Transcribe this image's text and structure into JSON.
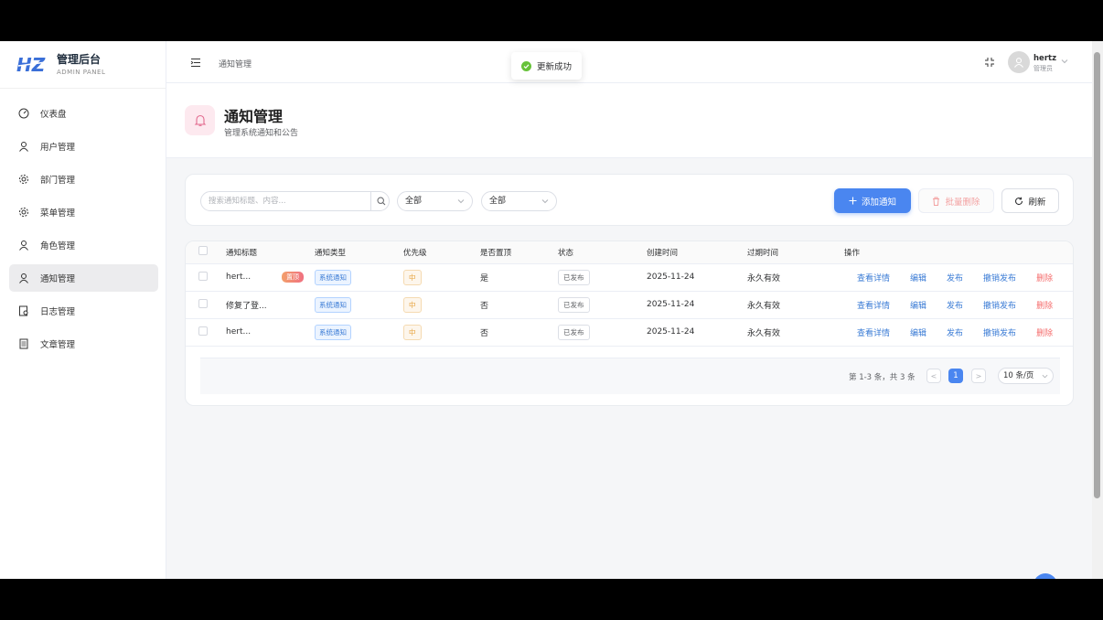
{
  "brand": {
    "logo_text": "HZ",
    "title": "管理后台",
    "subtitle": "ADMIN PANEL"
  },
  "sidebar": {
    "items": [
      {
        "label": "仪表盘",
        "icon": "dashboard-icon"
      },
      {
        "label": "用户管理",
        "icon": "user-icon"
      },
      {
        "label": "部门管理",
        "icon": "gear-icon"
      },
      {
        "label": "菜单管理",
        "icon": "gear-icon"
      },
      {
        "label": "角色管理",
        "icon": "user-icon"
      },
      {
        "label": "通知管理",
        "icon": "user-icon",
        "active": true
      },
      {
        "label": "日志管理",
        "icon": "log-icon"
      },
      {
        "label": "文章管理",
        "icon": "document-icon"
      }
    ]
  },
  "header": {
    "breadcrumb": "通知管理",
    "user_name": "hertz",
    "user_role": "管理员"
  },
  "toast": {
    "text": "更新成功"
  },
  "page": {
    "title": "通知管理",
    "subtitle": "管理系统通知和公告"
  },
  "toolbar": {
    "search_placeholder": "搜索通知标题、内容...",
    "filter_type": "全部",
    "filter_status": "全部",
    "add_label": "添加通知",
    "batch_delete_label": "批量删除",
    "refresh_label": "刷新"
  },
  "table": {
    "columns": [
      "通知标题",
      "通知类型",
      "优先级",
      "是否置顶",
      "状态",
      "创建时间",
      "过期时间",
      "操作"
    ],
    "rows": [
      {
        "title": "hert...",
        "pinned": "置顶",
        "type": "系统通知",
        "priority": "中",
        "top": "是",
        "status": "已发布",
        "created": "2025-11-24",
        "expires": "永久有效"
      },
      {
        "title": "修复了登...",
        "pinned": "",
        "type": "系统通知",
        "priority": "中",
        "top": "否",
        "status": "已发布",
        "created": "2025-11-24",
        "expires": "永久有效"
      },
      {
        "title": "hert...",
        "pinned": "",
        "type": "系统通知",
        "priority": "中",
        "top": "否",
        "status": "已发布",
        "created": "2025-11-24",
        "expires": "永久有效"
      }
    ],
    "actions": [
      "查看详情",
      "编辑",
      "发布",
      "撤销发布",
      "删除"
    ]
  },
  "pagination": {
    "total_text": "第 1-3 条，共 3 条",
    "current": "1",
    "prev": "<",
    "next": ">",
    "page_size": "10 条/页"
  },
  "colors": {
    "primary": "#4a86f0",
    "danger": "#f56c6c",
    "success": "#67c23a",
    "pink_bg": "#fde9ef"
  }
}
